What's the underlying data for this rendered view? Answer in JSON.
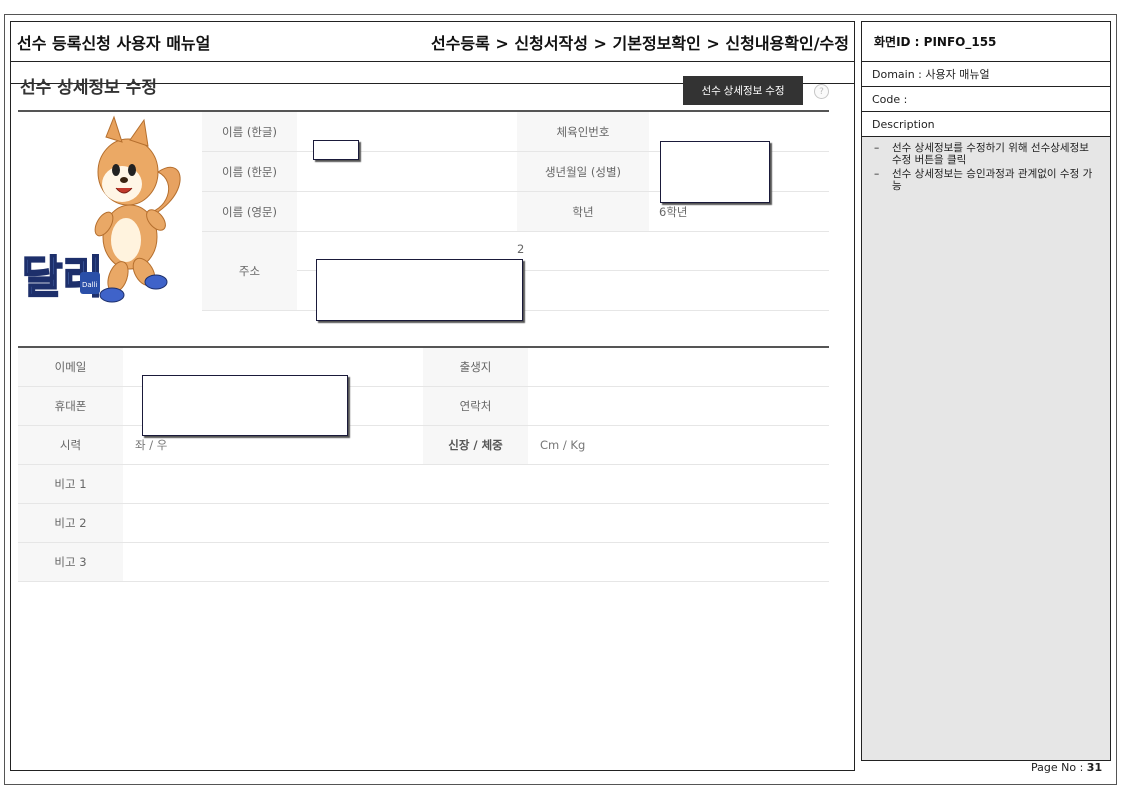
{
  "doc": {
    "title": "선수 등록신청 사용자 매뉴얼",
    "breadcrumb": "선수등록 > 신청서작성 > 기본정보확인 > 신청내용확인/수정"
  },
  "page": {
    "heading": "선수 상세정보 수정",
    "edit_button": "선수 상세정보 수정",
    "help_icon": "?"
  },
  "mascot": {
    "logo_text": "달리",
    "logo_sub": "Dalli"
  },
  "basic_info": {
    "name_kr_label": "이름 (한글)",
    "name_hanja_label": "이름 (한문)",
    "name_en_label": "이름 (영문)",
    "address_label": "주소",
    "sport_id_label": "체육인번호",
    "birth_label": "생년월일 (성별)",
    "grade_label": "학년",
    "grade_value": "6학년",
    "address_fragment": "2"
  },
  "contact": {
    "email_label": "이메일",
    "mobile_label": "휴대폰",
    "vision_label": "시력",
    "vision_value": "좌 / 우",
    "birthplace_label": "출생지",
    "phone_label": "연락처",
    "body_label": "신장 / 체중",
    "body_value": "Cm / Kg",
    "note1_label": "비고 1",
    "note2_label": "비고 2",
    "note3_label": "비고 3"
  },
  "panel": {
    "screen_id": "화면ID : PINFO_155",
    "domain": "Domain : 사용자 매뉴얼",
    "code": "Code :",
    "description_label": "Description",
    "descriptions": [
      "선수 상세정보를 수정하기 위해 선수상세정보 수정 버튼을 클릭",
      "선수 상세정보는 승인과정과 관계없이 수정 가능"
    ]
  },
  "footer": {
    "page_label": "Page No :",
    "page_number": "31"
  },
  "colors": {
    "button_bg": "#333333",
    "label_bg": "#f7f7f7",
    "panel_bg": "#e6e6e6",
    "redaction_border": "#1a1a3a"
  }
}
